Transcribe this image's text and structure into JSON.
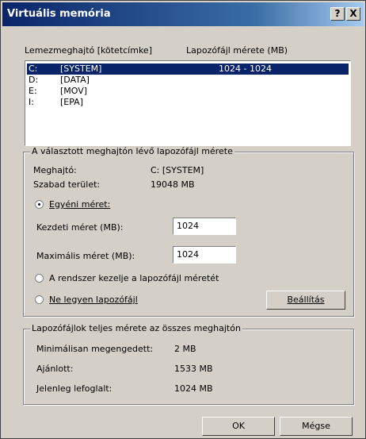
{
  "window": {
    "title": "Virtuális memória",
    "help_label": "?",
    "close_label": "X"
  },
  "drives": {
    "col_drive": "Lemezmeghajtó [kötetcímke]",
    "col_size": "Lapozófájl mérete (MB)",
    "rows": [
      {
        "letter": "C:",
        "label": "[SYSTEM]",
        "size": "1024 - 1024",
        "selected": true
      },
      {
        "letter": "D:",
        "label": "[DATA]",
        "size": "",
        "selected": false
      },
      {
        "letter": "E:",
        "label": "[MOV]",
        "size": "",
        "selected": false
      },
      {
        "letter": "I:",
        "label": "[EPA]",
        "size": "",
        "selected": false
      }
    ]
  },
  "selected_drive": {
    "group_title": "A választott meghajtón lévő lapozófájl mérete",
    "drive_label": "Meghajtó:",
    "drive_value": "C:  [SYSTEM]",
    "free_label": "Szabad terület:",
    "free_value": "19048 MB",
    "custom_label": "Egyéni méret:",
    "initial_label": "Kezdeti méret (MB):",
    "initial_value": "1024",
    "max_label": "Maximális méret (MB):",
    "max_value": "1024",
    "system_managed_label": "A rendszer kezelje a lapozófájl méretét",
    "no_pagefile_label": "Ne legyen lapozófájl",
    "set_button": "Beállítás"
  },
  "totals": {
    "group_title": "Lapozófájlok teljes mérete az összes meghajtón",
    "min_label": "Minimálisan megengedett:",
    "min_value": "2 MB",
    "recommended_label": "Ajánlott:",
    "recommended_value": "1533 MB",
    "current_label": "Jelenleg lefoglalt:",
    "current_value": "1024 MB"
  },
  "footer": {
    "ok_label": "OK",
    "cancel_label": "Mégse"
  }
}
